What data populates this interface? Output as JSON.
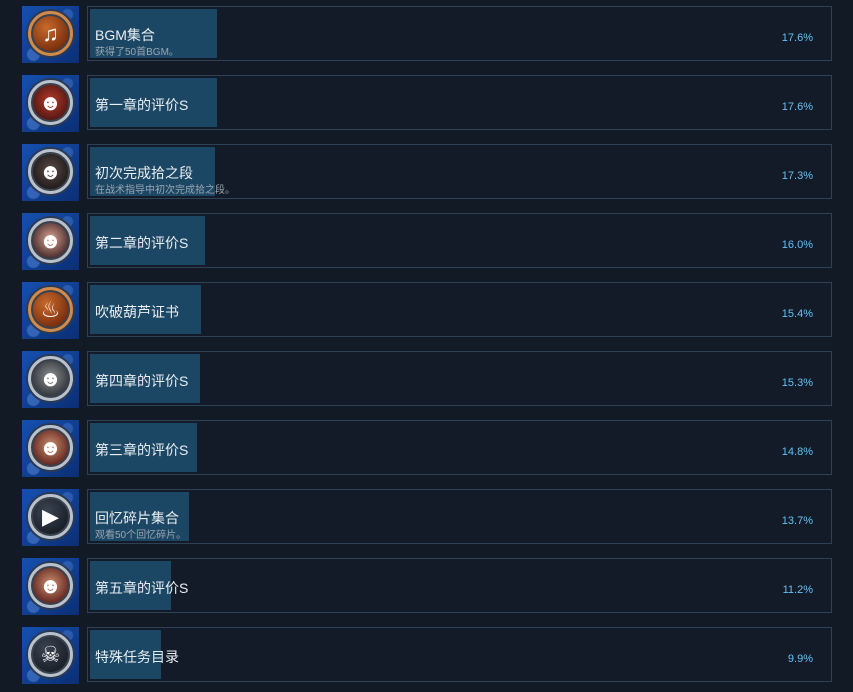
{
  "achievements": [
    {
      "title": "BGM集合",
      "description": "获得了50首BGM。",
      "percent": "17.6%",
      "percent_value": 17.6,
      "icon": "music-note-icon",
      "medal": "medal-bronze",
      "glyph": "♫"
    },
    {
      "title": "第一章的评价S",
      "description": "",
      "percent": "17.6%",
      "percent_value": 17.6,
      "icon": "character-portrait-icon",
      "medal": "medal-face-red",
      "glyph": "☻"
    },
    {
      "title": "初次完成拾之段",
      "description": "在战术指导中初次完成拾之段。",
      "percent": "17.3%",
      "percent_value": 17.3,
      "icon": "character-portrait-icon",
      "medal": "medal-face-dark",
      "glyph": "☻"
    },
    {
      "title": "第二章的评价S",
      "description": "",
      "percent": "16.0%",
      "percent_value": 16.0,
      "icon": "character-portrait-icon",
      "medal": "medal-face-pink",
      "glyph": "☻"
    },
    {
      "title": "吹破葫芦证书",
      "description": "",
      "percent": "15.4%",
      "percent_value": 15.4,
      "icon": "gourd-icon",
      "medal": "medal-bronze",
      "glyph": "♨"
    },
    {
      "title": "第四章的评价S",
      "description": "",
      "percent": "15.3%",
      "percent_value": 15.3,
      "icon": "character-portrait-icon",
      "medal": "medal-face-grey",
      "glyph": "☻"
    },
    {
      "title": "第三章的评价S",
      "description": "",
      "percent": "14.8%",
      "percent_value": 14.8,
      "icon": "character-portrait-icon",
      "medal": "medal-face-teal",
      "glyph": "☻"
    },
    {
      "title": "回忆碎片集合",
      "description": "观看50个回忆碎片。",
      "percent": "13.7%",
      "percent_value": 13.7,
      "icon": "film-play-icon",
      "medal": "medal-dark",
      "glyph": "▶"
    },
    {
      "title": "第五章的评价S",
      "description": "",
      "percent": "11.2%",
      "percent_value": 11.2,
      "icon": "character-portrait-icon",
      "medal": "medal-face-teal",
      "glyph": "☻"
    },
    {
      "title": "特殊任务目录",
      "description": "",
      "percent": "9.9%",
      "percent_value": 9.9,
      "icon": "oni-mask-icon",
      "medal": "medal-dark",
      "glyph": "☠"
    }
  ]
}
